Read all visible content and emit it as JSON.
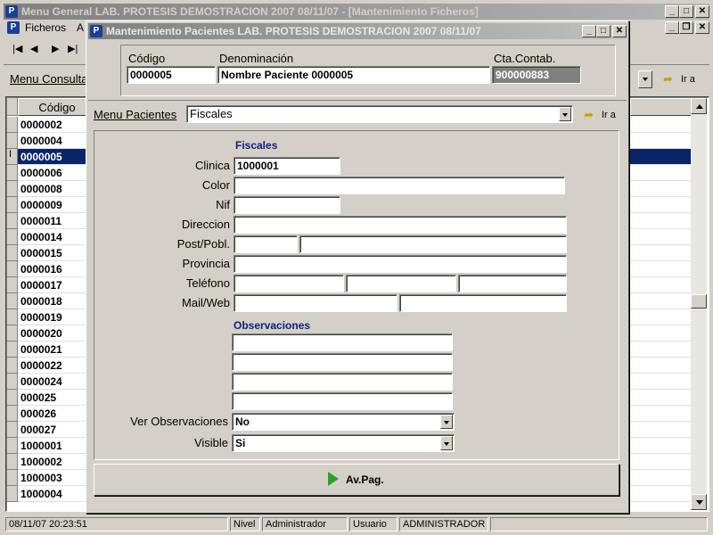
{
  "main_window": {
    "title": "Menu General   LAB. PROTESIS DEMOSTRACION   2007   08/11/07 - [Mantenimiento Ficheros]",
    "app_icon": "P",
    "menu": {
      "ficheros": "Ficheros",
      "a": "A"
    },
    "menu_consulta": "Menu Consulta",
    "ir_a": "Ir a",
    "grid_header": "Código",
    "rows": [
      "0000002",
      "0000004",
      "0000005",
      "0000006",
      "0000008",
      "0000009",
      "0000011",
      "0000014",
      "0000015",
      "0000016",
      "0000017",
      "0000018",
      "0000019",
      "0000020",
      "0000021",
      "0000022",
      "0000024",
      "000025",
      "000026",
      "000027",
      "1000001",
      "1000002",
      "1000003",
      "1000004"
    ],
    "selected_row": "0000005",
    "row_marker": "I"
  },
  "dialog": {
    "title": "Mantenimiento Pacientes   LAB. PROTESIS DEMOSTRACION   2007   08/11/07",
    "header": {
      "codigo_label": "Código",
      "codigo_value": "0000005",
      "denominacion_label": "Denominación",
      "denominacion_value": "Nombre Paciente 0000005",
      "cta_label": "Cta.Contab.",
      "cta_value": "900000883"
    },
    "menu_pacientes_label": "Menu Pacientes",
    "menu_pacientes_value": "Fiscales",
    "ir_a": "Ir a",
    "section_fiscales": "Fiscales",
    "fields": {
      "clinica_label": "Clinica",
      "clinica_value": "1000001",
      "color_label": "Color",
      "nif_label": "Nif",
      "direccion_label": "Direccion",
      "post_label": "Post/Pobl.",
      "provincia_label": "Provincia",
      "telefono_label": "Teléfono",
      "mail_label": "Mail/Web"
    },
    "section_observaciones": "Observaciones",
    "ver_obs_label": "Ver Observaciones",
    "ver_obs_value": "No",
    "visible_label": "Visible",
    "visible_value": "Si",
    "av_pag_label": "Av.Pag."
  },
  "status": {
    "datetime": "08/11/07 20:23:51",
    "nivel_label": "Nivel",
    "nivel_value": "Administrador",
    "usuario_label": "Usuario",
    "usuario_value": "ADMINISTRADOR"
  }
}
